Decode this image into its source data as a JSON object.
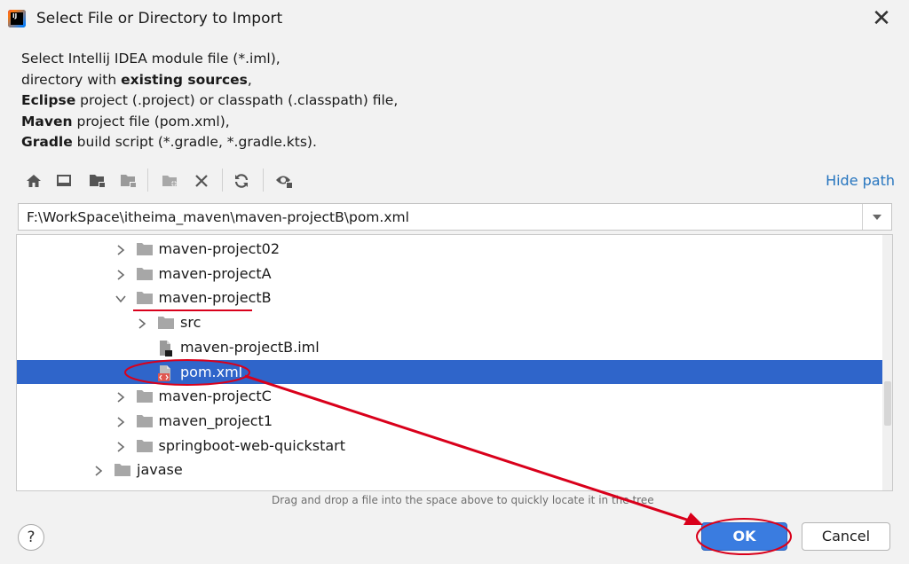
{
  "window": {
    "title": "Select File or Directory to Import"
  },
  "description": {
    "lines": [
      [
        {
          "t": "Select Intellij IDEA module file (*.iml),",
          "b": false
        }
      ],
      [
        {
          "t": "directory with ",
          "b": false
        },
        {
          "t": "existing sources",
          "b": true
        },
        {
          "t": ",",
          "b": false
        }
      ],
      [
        {
          "t": "Eclipse",
          "b": true
        },
        {
          "t": " project (.project) or classpath (.classpath) file,",
          "b": false
        }
      ],
      [
        {
          "t": "Maven",
          "b": true
        },
        {
          "t": " project file (pom.xml),",
          "b": false
        }
      ],
      [
        {
          "t": "Gradle",
          "b": true
        },
        {
          "t": " build script (*.gradle, *.gradle.kts).",
          "b": false
        }
      ]
    ]
  },
  "toolbar": {
    "icons": [
      "home-icon",
      "desktop-icon",
      "project-folder-icon",
      "module-folder-icon",
      "new-folder-icon",
      "delete-icon",
      "refresh-icon",
      "show-hidden-icon"
    ],
    "hide_path_label": "Hide path"
  },
  "path": {
    "value": "F:\\WorkSpace\\itheima_maven\\maven-projectB\\pom.xml"
  },
  "tree": {
    "rows": [
      {
        "label": "maven-project02",
        "level": 3,
        "chevron": "right",
        "icon": "folder-icon",
        "selected": false
      },
      {
        "label": "maven-projectA",
        "level": 3,
        "chevron": "right",
        "icon": "folder-icon",
        "selected": false
      },
      {
        "label": "maven-projectB",
        "level": 3,
        "chevron": "down",
        "icon": "folder-icon",
        "selected": false
      },
      {
        "label": "src",
        "level": 4,
        "chevron": "right",
        "icon": "folder-icon",
        "selected": false
      },
      {
        "label": "maven-projectB.iml",
        "level": 4,
        "chevron": "none",
        "icon": "iml-file-icon",
        "selected": false
      },
      {
        "label": "pom.xml",
        "level": 4,
        "chevron": "none",
        "icon": "maven-file-icon",
        "selected": true
      },
      {
        "label": "maven-projectC",
        "level": 3,
        "chevron": "right",
        "icon": "folder-icon",
        "selected": false
      },
      {
        "label": "maven_project1",
        "level": 3,
        "chevron": "right",
        "icon": "folder-icon",
        "selected": false
      },
      {
        "label": "springboot-web-quickstart",
        "level": 3,
        "chevron": "right",
        "icon": "folder-icon",
        "selected": false
      },
      {
        "label": "javase",
        "level": 2,
        "chevron": "right",
        "icon": "folder-icon",
        "selected": false
      }
    ]
  },
  "hint": "Drag and drop a file into the space above to quickly locate it in the tree",
  "footer": {
    "help_label": "?",
    "ok_label": "OK",
    "cancel_label": "Cancel"
  },
  "colors": {
    "accent": "#2f65ca",
    "annotation": "#d9001b",
    "link": "#2675bf"
  }
}
